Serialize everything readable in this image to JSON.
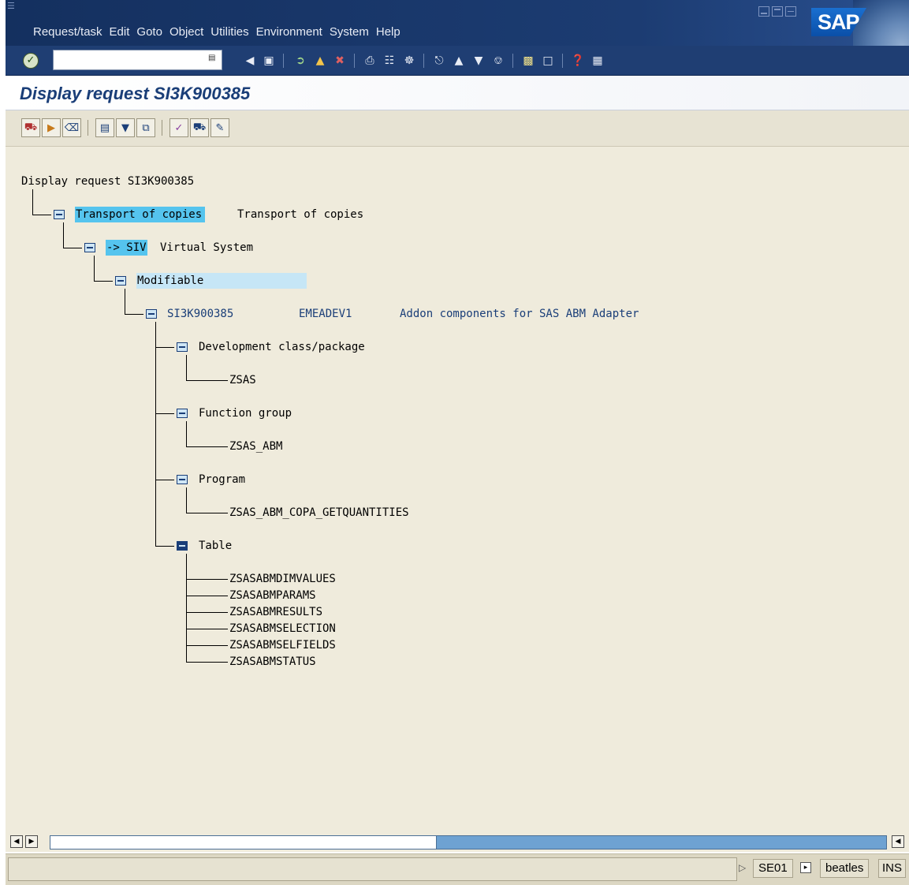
{
  "window": {
    "menu": [
      {
        "label": "Request/task"
      },
      {
        "label": "Edit"
      },
      {
        "label": "Goto"
      },
      {
        "label": "Object"
      },
      {
        "label": "Utilities"
      },
      {
        "label": "Environment"
      },
      {
        "label": "System"
      },
      {
        "label": "Help"
      }
    ],
    "logo_text": "SAP"
  },
  "command_field": {
    "value": ""
  },
  "screen": {
    "title": "Display request SI3K900385"
  },
  "tree": {
    "root": "Display request SI3K900385",
    "level1": {
      "key": "Transport of copies",
      "label": "Transport of copies"
    },
    "level2": {
      "key": "-> SIV",
      "label": "Virtual System"
    },
    "level3": {
      "key": "Modifiable"
    },
    "request": {
      "id": "SI3K900385",
      "owner": "EMEADEV1",
      "description": "Addon components for SAS ABM Adapter"
    },
    "categories": [
      {
        "label": "Development class/package",
        "items": [
          "ZSAS"
        ]
      },
      {
        "label": "Function group",
        "items": [
          "ZSAS_ABM"
        ]
      },
      {
        "label": "Program",
        "items": [
          "ZSAS_ABM_COPA_GETQUANTITIES"
        ]
      },
      {
        "label": "Table",
        "items": [
          "ZSASABMDIMVALUES",
          "ZSASABMPARAMS",
          "ZSASABMRESULTS",
          "ZSASABMSELECTION",
          "ZSASABMSELFIELDS",
          "ZSASABMSTATUS"
        ]
      }
    ]
  },
  "status": {
    "transaction": "SE01",
    "user": "beatles",
    "mode": "INS"
  },
  "colors": {
    "title_bar": "#1c3769",
    "highlight": "#55c4ee",
    "highlight_light": "#c6e6f6",
    "background": "#efebdc",
    "title_text": "#1a3e78"
  }
}
